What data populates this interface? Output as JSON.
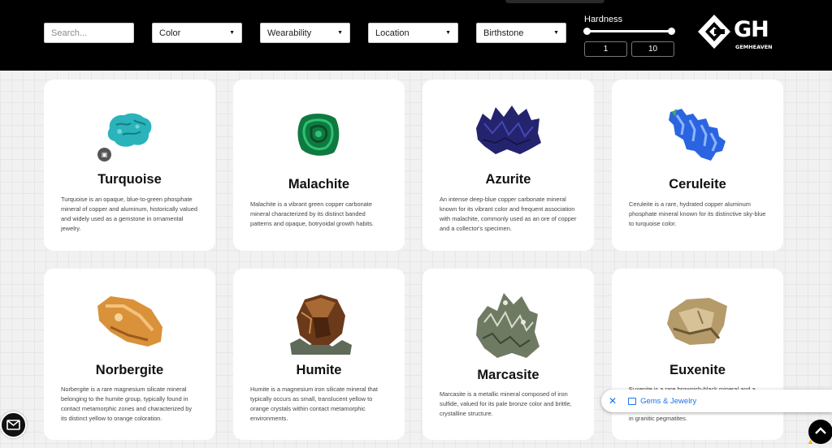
{
  "header": {
    "search_placeholder": "Search...",
    "filters": [
      {
        "label": "Color"
      },
      {
        "label": "Wearability"
      },
      {
        "label": "Location"
      },
      {
        "label": "Birthstone"
      }
    ],
    "hardness": {
      "label": "Hardness",
      "min": "1",
      "max": "10",
      "range_min": 1,
      "range_max": 10
    },
    "logo": {
      "text": "GH",
      "subtitle": "GEMHEAVEN"
    }
  },
  "gems": [
    {
      "name": "Turquoise",
      "description": "Turquoise is an opaque, blue-to-green phosphate mineral of copper and aluminum, historically valued and widely used as a gemstone in ornamental jewelry.",
      "color": "#2bb3bb"
    },
    {
      "name": "Malachite",
      "description": "Malachite is a vibrant green copper carbonate mineral characterized by its distinct banded patterns and opaque, botryoidal growth habits.",
      "color": "#0f8a4a"
    },
    {
      "name": "Azurite",
      "description": "An intense deep-blue copper carbonate mineral known for its vibrant color and frequent association with malachite, commonly used as an ore of copper and a collector's specimen.",
      "color": "#2b2b7a"
    },
    {
      "name": "Ceruleite",
      "description": "Ceruleite is a rare, hydrated copper aluminum phosphate mineral known for its distinctive sky-blue to turquoise color.",
      "color": "#2a64e0"
    },
    {
      "name": "Norbergite",
      "description": "Norbergite is a rare magnesium silicate mineral belonging to the humite group, typically found in contact metamorphic zones and characterized by its distinct yellow to orange coloration.",
      "color": "#d9923a"
    },
    {
      "name": "Humite",
      "description": "Humite is a magnesium iron silicate mineral that typically occurs as small, translucent yellow to orange crystals within contact metamorphic environments.",
      "color": "#6b3a1a"
    },
    {
      "name": "Marcasite",
      "description": "Marcasite is a metallic mineral composed of iron sulfide, valued for its pale bronze color and brittle, crystalline structure.",
      "color": "#7c8a6a"
    },
    {
      "name": "Euxenite",
      "description": "Euxenite is a rare brownish-black mineral and a in granitic pegmatites.",
      "description_top": "Euxenite is a rare brownish-black mineral and a",
      "description_bottom": "in granitic pegmatites.",
      "color": "#b59a6a"
    }
  ],
  "toast": {
    "label": "Gems & Jewelry",
    "accent": "#1a73e8"
  },
  "colors": {
    "header_bg": "#000000",
    "card_bg": "#ffffff",
    "page_bg": "#f1f1f1"
  }
}
